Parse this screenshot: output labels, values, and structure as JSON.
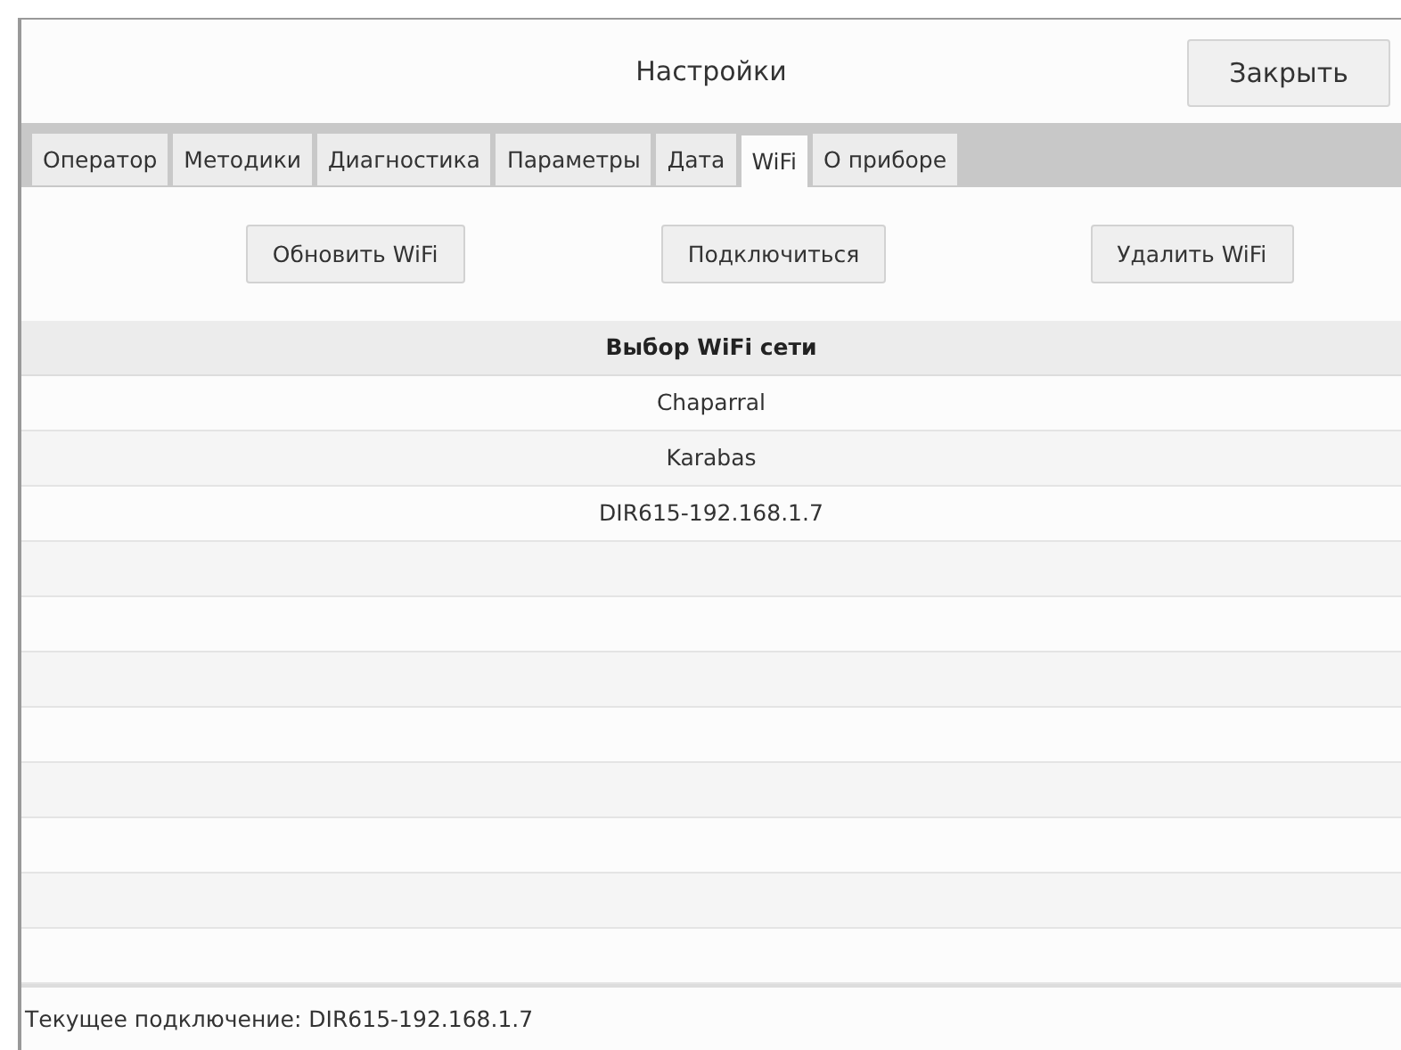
{
  "window": {
    "title": "Настройки",
    "close_button": "Закрыть"
  },
  "tabs": [
    {
      "label": "Оператор",
      "selected": false
    },
    {
      "label": "Методики",
      "selected": false
    },
    {
      "label": "Диагностика",
      "selected": false
    },
    {
      "label": "Параметры",
      "selected": false
    },
    {
      "label": "Дата",
      "selected": false
    },
    {
      "label": "WiFi",
      "selected": true
    },
    {
      "label": "О приборе",
      "selected": false
    }
  ],
  "buttons": [
    "Обновить WiFi",
    "Подключиться",
    "Удалить WiFi"
  ],
  "table": {
    "header": "Выбор WiFi сети",
    "rows": [
      "Chaparral",
      "Karabas",
      "DIR615-192.168.1.7"
    ]
  },
  "status_bar": "Текущее подключение: DIR615-192.168.1.7"
}
